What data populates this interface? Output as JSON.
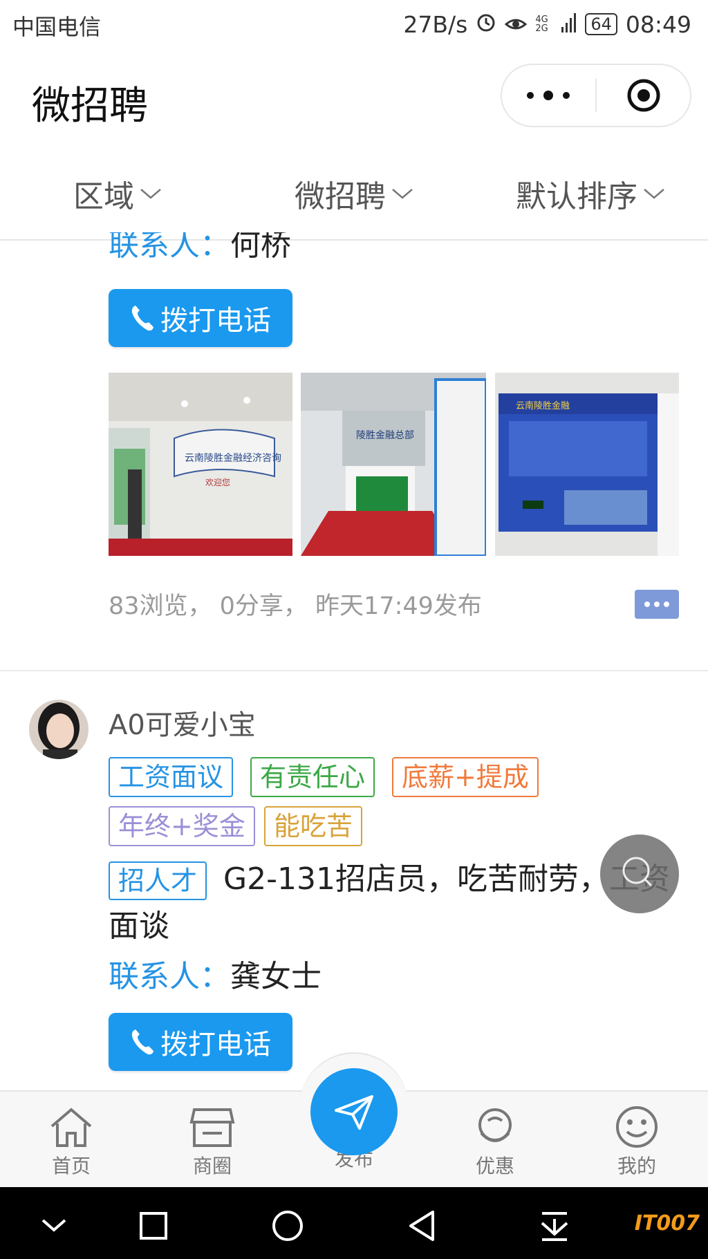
{
  "status_bar": {
    "carrier": "中国电信",
    "net_speed": "27B/s",
    "network": "4G 2G",
    "battery": "64",
    "time": "08:49"
  },
  "title_bar": {
    "title": "微招聘"
  },
  "filters": [
    {
      "label": "区域"
    },
    {
      "label": "微招聘"
    },
    {
      "label": "默认排序"
    }
  ],
  "post1": {
    "contact_label": "联系人：",
    "contact_name": "何桥",
    "call_label": "拨打电话",
    "photos": [
      "云南陵胜金融经济咨询有限公司 欢迎您",
      "陵胜金融总部",
      "云南陵胜金融"
    ],
    "stats": "83浏览， 0分享， 昨天17:49发布"
  },
  "post2": {
    "username": "A0可爱小宝",
    "tags": [
      {
        "text": "工资面议",
        "color": "#2593e3"
      },
      {
        "text": "有责任心",
        "color": "#3aa845"
      },
      {
        "text": "底薪+提成",
        "color": "#f07a3c"
      },
      {
        "text": "年终+奖金",
        "color": "#9b8fd6"
      },
      {
        "text": "能吃苦",
        "color": "#d8a33a"
      }
    ],
    "type_tag": "招人才",
    "text": "G2-131招店员，吃苦耐劳，工资面谈",
    "contact_label": "联系人：",
    "contact_name": "龚女士",
    "call_label": "拨打电话"
  },
  "bottom_nav": [
    {
      "label": "首页",
      "icon": "home-icon"
    },
    {
      "label": "商圈",
      "icon": "shop-icon"
    },
    {
      "label": "发布",
      "icon": "send-icon"
    },
    {
      "label": "优惠",
      "icon": "coupon-icon"
    },
    {
      "label": "我的",
      "icon": "smile-icon"
    }
  ],
  "watermark": "IT007",
  "colors": {
    "accent_blue": "#1a99ef",
    "label_blue": "#2593e3"
  }
}
